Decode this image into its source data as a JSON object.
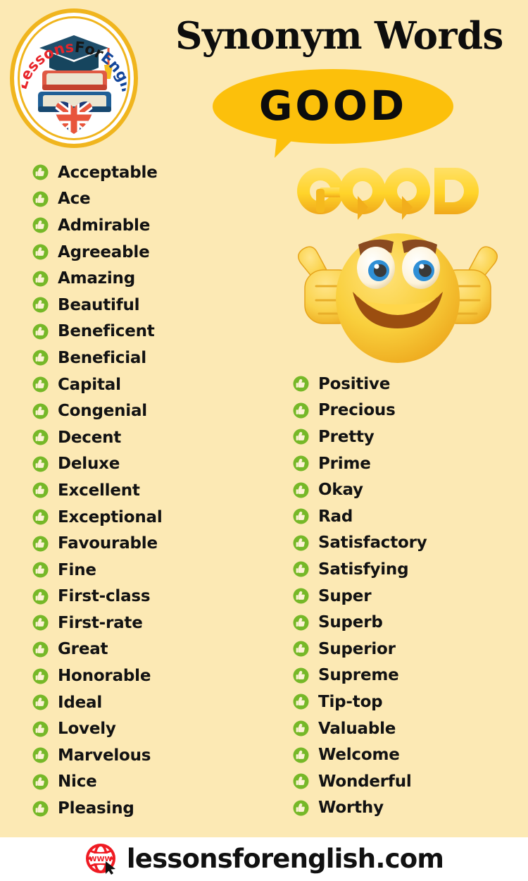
{
  "header": {
    "title": "Synonym Words",
    "bubble_word": "GOOD",
    "bubble_color": "#fcc00b",
    "logo": {
      "text_lessons": "Lessons",
      "text_for": "For",
      "text_english": "English.Com",
      "color_lessons": "#e8252a",
      "color_for": "#161616",
      "color_english": "#12459a",
      "ring_color": "#f0b51e"
    }
  },
  "illustration": {
    "word_3d": "GOOD",
    "character": "smiley-two-thumbs-up",
    "face_color": "#f9cf3c",
    "brow_color": "#8a4a20"
  },
  "page": {
    "background_color": "#fce9b4",
    "bullet_color": "#76b828",
    "text_color": "#121212"
  },
  "columns": {
    "left": [
      "Acceptable",
      "Ace",
      "Admirable",
      "Agreeable",
      "Amazing",
      "Beautiful",
      "Beneficent",
      "Beneficial",
      "Capital",
      "Congenial",
      "Decent",
      "Deluxe",
      "Excellent",
      "Exceptional",
      "Favourable",
      "Fine",
      "First-class",
      "First-rate",
      "Great",
      "Honorable",
      "Ideal",
      "Lovely",
      "Marvelous",
      "Nice",
      "Pleasing"
    ],
    "right": [
      "Positive",
      "Precious",
      "Pretty",
      "Prime",
      "Okay",
      "Rad",
      "Satisfactory",
      "Satisfying",
      "Super",
      "Superb",
      "Superior",
      "Supreme",
      "Tip-top",
      "Valuable",
      "Welcome",
      "Wonderful",
      "Worthy"
    ]
  },
  "footer": {
    "site": "lessonsforenglish.com",
    "globe_label": "WWW",
    "globe_color": "#ef1b23"
  }
}
